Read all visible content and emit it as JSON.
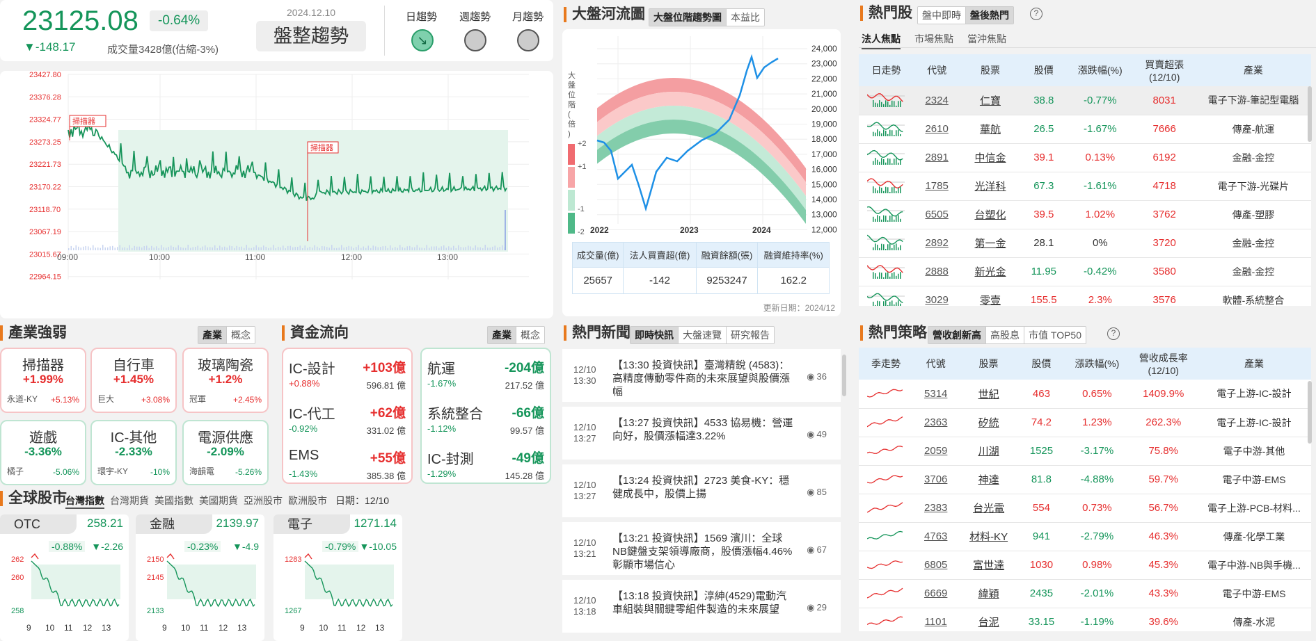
{
  "index": {
    "value": "23125.08",
    "pct": "-0.64%",
    "change": "▼-148.17",
    "volume": "成交量3428億(估縮-3%)",
    "date": "2024.12.10",
    "trend": "盤整趨勢",
    "daily": "日趨勢",
    "weekly": "週趨勢",
    "monthly": "月趨勢"
  },
  "intraday": {
    "y_ticks": [
      "23427.80",
      "23376.28",
      "23324.77",
      "23273.25",
      "23221.73",
      "23170.22",
      "23118.70",
      "23067.19",
      "23015.67",
      "22964.15"
    ],
    "x_ticks": [
      "09:00",
      "10:00",
      "11:00",
      "12:00",
      "13:00"
    ],
    "marker1": "掃描器",
    "marker2": "掃描器"
  },
  "river": {
    "title": "大盤河流圖",
    "tabs": [
      "大盤位階趨勢圖",
      "本益比"
    ],
    "y_ticks": [
      "24,000",
      "23,000",
      "22,000",
      "21,000",
      "20,000",
      "19,000",
      "18,000",
      "17,000",
      "16,000",
      "15,000",
      "14,000",
      "13,000",
      "12,000"
    ],
    "x_ticks": [
      "2022",
      "2023",
      "2024"
    ],
    "legend_title": "大盤位階(倍)",
    "legend": [
      "+2",
      "+1",
      "-1",
      "-2"
    ],
    "headers": [
      "成交量(億)",
      "法人買賣超(億)",
      "融資餘額(張)",
      "融資維持率(%)"
    ],
    "values": [
      "25657",
      "-142",
      "9253247",
      "162.2"
    ],
    "update": "更新日期：2024/12"
  },
  "hot": {
    "title": "熱門股",
    "tabs": [
      "盤中即時",
      "盤後熱門"
    ],
    "subtabs": [
      "法人焦點",
      "市場焦點",
      "當沖焦點"
    ],
    "headers": [
      "日走勢",
      "代號",
      "股票",
      "股價",
      "漲跌幅(%)",
      "買賣超張\n(12/10)",
      "產業"
    ],
    "rows": [
      [
        "2324",
        "仁寶",
        "38.8",
        "-0.77%",
        "8031",
        "電子下游-筆記型電腦"
      ],
      [
        "2610",
        "華航",
        "26.5",
        "-1.67%",
        "7666",
        "傳產-航運"
      ],
      [
        "2891",
        "中信金",
        "39.1",
        "0.13%",
        "6192",
        "金融-金控"
      ],
      [
        "1785",
        "光洋科",
        "67.3",
        "-1.61%",
        "4718",
        "電子下游-光碟片"
      ],
      [
        "6505",
        "台塑化",
        "39.5",
        "1.02%",
        "3762",
        "傳產-塑膠"
      ],
      [
        "2892",
        "第一金",
        "28.1",
        "0%",
        "3720",
        "金融-金控"
      ],
      [
        "2888",
        "新光金",
        "11.95",
        "-0.42%",
        "3580",
        "金融-金控"
      ],
      [
        "3029",
        "零壹",
        "155.5",
        "2.3%",
        "3576",
        "軟體-系統整合"
      ]
    ]
  },
  "industry": {
    "title": "產業強弱",
    "tabs": [
      "產業",
      "概念"
    ],
    "items": [
      [
        "掃描器",
        "+1.99%",
        "永道-KY",
        "+5.13%"
      ],
      [
        "自行車",
        "+1.45%",
        "巨大",
        "+3.08%"
      ],
      [
        "玻璃陶瓷",
        "+1.2%",
        "冠軍",
        "+2.45%"
      ],
      [
        "遊戲",
        "-3.36%",
        "橘子",
        "-5.06%"
      ],
      [
        "IC-其他",
        "-2.33%",
        "環宇-KY",
        "-10%"
      ],
      [
        "電源供應",
        "-2.09%",
        "海韻電",
        "-5.26%"
      ]
    ]
  },
  "flow": {
    "title": "資金流向",
    "tabs": [
      "產業",
      "概念"
    ],
    "up": [
      [
        "IC-設計",
        "+103億",
        "+0.88%",
        "596.81 億"
      ],
      [
        "IC-代工",
        "+62億",
        "-0.92%",
        "331.02 億"
      ],
      [
        "EMS",
        "+55億",
        "-1.43%",
        "385.38 億"
      ]
    ],
    "down": [
      [
        "航運",
        "-204億",
        "-1.67%",
        "217.52 億"
      ],
      [
        "系統整合",
        "-66億",
        "-1.12%",
        "99.57 億"
      ],
      [
        "IC-封測",
        "-49億",
        "-1.29%",
        "145.28 億"
      ]
    ]
  },
  "news": {
    "title": "熱門新聞",
    "tabs": [
      "即時快訊",
      "大盤速覽",
      "研究報告"
    ],
    "items": [
      [
        "12/10\n13:30",
        "【13:30 投資快訊】臺灣精銳 (4583)：高精度傳動零件商的未來展望與股價漲幅",
        "36"
      ],
      [
        "12/10\n13:27",
        "【13:27 投資快訊】4533 協易機：營運向好，股價漲幅達3.22%",
        "49"
      ],
      [
        "12/10\n13:27",
        "【13:24 投資快訊】2723 美食-KY：穩健成長中，股價上揚",
        "85"
      ],
      [
        "12/10\n13:21",
        "【13:21 投資快訊】1569 濱川：全球NB鍵盤支架領導廠商，股價漲幅4.46%彰顯市場信心",
        "67"
      ],
      [
        "12/10\n13:18",
        "【13:18 投資快訊】淳紳(4529)電動汽車組裝與關鍵零組件製造的未來展望",
        "29"
      ]
    ]
  },
  "strategy": {
    "title": "熱門策略",
    "tabs": [
      "營收創新高",
      "高股息",
      "市值 TOP50"
    ],
    "headers": [
      "季走勢",
      "代號",
      "股票",
      "股價",
      "漲跌幅(%)",
      "營收成長率\n(12/10)",
      "產業"
    ],
    "rows": [
      [
        "5314",
        "世紀",
        "463",
        "0.65%",
        "1409.9%",
        "電子上游-IC-設計"
      ],
      [
        "2363",
        "矽統",
        "74.2",
        "1.23%",
        "262.3%",
        "電子上游-IC-設計"
      ],
      [
        "2059",
        "川湖",
        "1525",
        "-3.17%",
        "75.8%",
        "電子中游-其他"
      ],
      [
        "3706",
        "神達",
        "81.8",
        "-4.88%",
        "59.7%",
        "電子中游-EMS"
      ],
      [
        "2383",
        "台光電",
        "554",
        "0.73%",
        "56.7%",
        "電子上游-PCB-材料..."
      ],
      [
        "4763",
        "材料-KY",
        "941",
        "-2.79%",
        "46.3%",
        "傳產-化學工業"
      ],
      [
        "6805",
        "富世達",
        "1030",
        "0.98%",
        "45.3%",
        "電子中游-NB與手機..."
      ],
      [
        "6669",
        "緯穎",
        "2435",
        "-2.01%",
        "43.3%",
        "電子中游-EMS"
      ],
      [
        "1101",
        "台泥",
        "33.15",
        "-1.19%",
        "39.6%",
        "傳產-水泥"
      ]
    ]
  },
  "global": {
    "title": "全球股市",
    "tabs": [
      "台灣指數",
      "台灣期貨",
      "美國指數",
      "美國期貨",
      "亞洲股市",
      "歐洲股市"
    ],
    "date": "日期：12/10",
    "cards": [
      {
        "name": "OTC",
        "value": "258.21",
        "pct": "-0.88%",
        "chg": "▼-2.26",
        "yt": [
          "262",
          "260",
          "258"
        ],
        "xt": [
          "9",
          "10",
          "11",
          "12",
          "13"
        ]
      },
      {
        "name": "金融",
        "value": "2139.97",
        "pct": "-0.23%",
        "chg": "▼-4.9",
        "yt": [
          "2150",
          "2145",
          "2133"
        ],
        "xt": [
          "9",
          "10",
          "11",
          "12",
          "13"
        ]
      },
      {
        "name": "電子",
        "value": "1271.14",
        "pct": "-0.79%",
        "chg": "▼-10.05",
        "yt": [
          "1283",
          "1267"
        ],
        "xt": [
          "9",
          "10",
          "11",
          "12",
          "13"
        ]
      }
    ]
  },
  "colors": {
    "up": "#e62e2e",
    "down": "#15955a",
    "accent": "#e8791d"
  }
}
